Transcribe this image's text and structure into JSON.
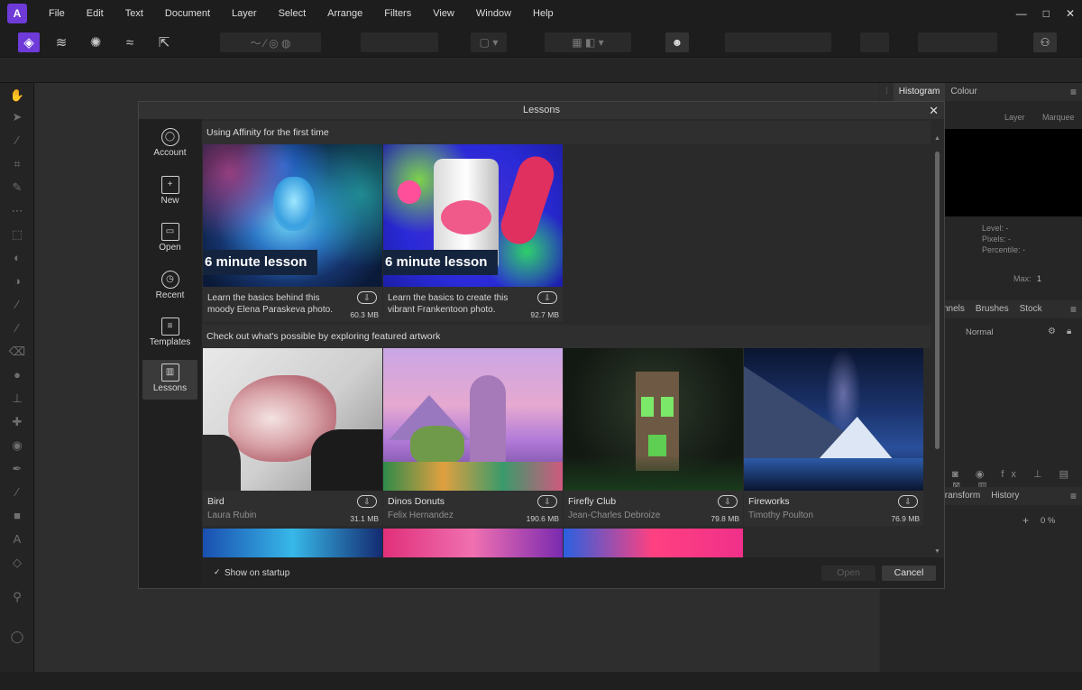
{
  "menubar": {
    "items": [
      "File",
      "Edit",
      "Text",
      "Document",
      "Layer",
      "Select",
      "Arrange",
      "Filters",
      "View",
      "Window",
      "Help"
    ]
  },
  "window_controls": {
    "minimize": "—",
    "maximize": "□",
    "close": "✕"
  },
  "right_panel": {
    "top_tabs": [
      "Histogram",
      "Colour"
    ],
    "layer_label": "Layer",
    "marquee_label": "Marquee",
    "stats": [
      "Level: -",
      "Pixels: -",
      "Percentile: -"
    ],
    "max_label": "Max:",
    "max_value": "1",
    "mid_tabs": [
      "nnels",
      "Brushes",
      "Stock"
    ],
    "blend_mode": "Normal",
    "bottom_tabs": [
      "Transform",
      "History"
    ],
    "zoom_value": "0 %"
  },
  "dialog": {
    "title": "Lessons",
    "close": "✕",
    "nav": [
      {
        "label": "Account",
        "icon": "account-icon",
        "glyph": "◯"
      },
      {
        "label": "New",
        "icon": "new-document-icon",
        "glyph": "+"
      },
      {
        "label": "Open",
        "icon": "folder-icon",
        "glyph": "▭"
      },
      {
        "label": "Recent",
        "icon": "clock-icon",
        "glyph": "◷"
      },
      {
        "label": "Templates",
        "icon": "templates-icon",
        "glyph": "≡"
      },
      {
        "label": "Lessons",
        "icon": "book-icon",
        "glyph": "▥"
      }
    ],
    "sections": [
      {
        "title": "Using Affinity for the first time",
        "cards": [
          {
            "badge": "6 minute lesson",
            "description": "Learn the basics behind this moody Elena Paraskeva photo.",
            "size": "60.3 MB"
          },
          {
            "badge": "6 minute lesson",
            "description": "Learn the basics to create this vibrant Frankentoon photo.",
            "size": "92.7 MB"
          }
        ]
      },
      {
        "title": "Check out what's possible by exploring featured artwork",
        "cards": [
          {
            "title": "Bird",
            "author": "Laura Rubin",
            "size": "31.1 MB"
          },
          {
            "title": "Dinos Donuts",
            "author": "Felix Hernandez",
            "size": "190.6 MB"
          },
          {
            "title": "Firefly Club",
            "author": "Jean-Charles Debroize",
            "size": "79.8 MB"
          },
          {
            "title": "Fireworks",
            "author": "Timothy Poulton",
            "size": "76.9 MB"
          }
        ]
      }
    ],
    "show_on_startup": {
      "label": "Show on startup",
      "checked": true
    },
    "buttons": {
      "open": "Open",
      "cancel": "Cancel"
    }
  }
}
